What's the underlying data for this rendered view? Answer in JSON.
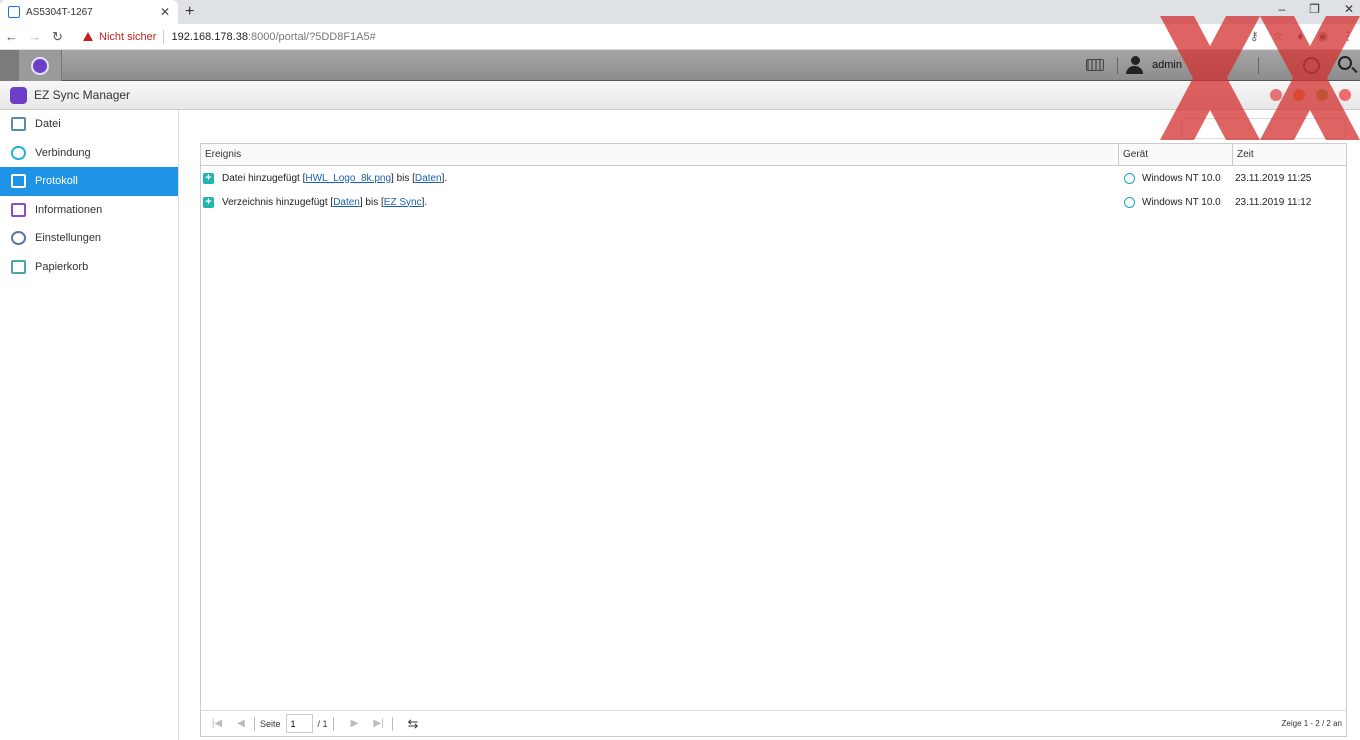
{
  "browser": {
    "tab_title": "AS5304T-1267",
    "security_label": "Nicht sicher",
    "url_host": "192.168.178.38",
    "url_rest": ":8000/portal/?5DD8F1A5#"
  },
  "topbar": {
    "username": "admin"
  },
  "window": {
    "title": "EZ Sync Manager"
  },
  "sidebar": {
    "items": [
      {
        "label": "Datei",
        "icon": "file-icon",
        "color": "#5a8bb5"
      },
      {
        "label": "Verbindung",
        "icon": "cloud-icon",
        "color": "#2ab0d8"
      },
      {
        "label": "Protokoll",
        "icon": "log-icon",
        "color": "#ffffff"
      },
      {
        "label": "Informationen",
        "icon": "list-icon",
        "color": "#8a4bd0"
      },
      {
        "label": "Einstellungen",
        "icon": "gear-icon",
        "color": "#5577aa"
      },
      {
        "label": "Papierkorb",
        "icon": "trash-icon",
        "color": "#4aa8a8"
      }
    ],
    "active_index": 2
  },
  "table": {
    "columns": [
      "Ereignis",
      "Gerät",
      "Zeit"
    ],
    "rows": [
      {
        "pre": "Datei hinzugefügt [",
        "link1": "HWL_Logo_8k.png",
        "mid": "] bis [",
        "link2": "Daten",
        "post": "].",
        "device": "Windows NT 10.0",
        "time": "23.11.2019 11:25"
      },
      {
        "pre": "Verzeichnis hinzugefügt [",
        "link1": "Daten",
        "mid": "] bis [",
        "link2": "EZ Sync",
        "post": "].",
        "device": "Windows NT 10.0",
        "time": "23.11.2019 11:12"
      }
    ]
  },
  "pager": {
    "page_label": "Seite",
    "page_value": "1",
    "page_total": "/ 1",
    "info": "Zeige 1 - 2 / 2 an"
  },
  "colors": {
    "accent": "#1f94e6",
    "add_icon": "#1fb6b0",
    "watermark": "#d32f2f"
  }
}
